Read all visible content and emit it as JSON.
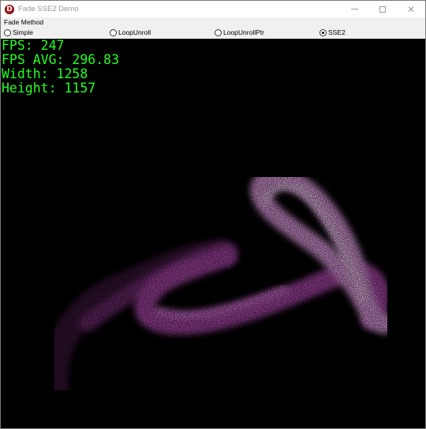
{
  "window": {
    "title": "Fade SSE2 Demo",
    "app_icon_letter": "D",
    "controls": [
      "minimize-icon",
      "maximize-icon",
      "close-icon"
    ]
  },
  "fade_method": {
    "label": "Fade Method",
    "options": [
      {
        "label": "Simple",
        "checked": false
      },
      {
        "label": "LoopUnroll",
        "checked": false
      },
      {
        "label": "LoopUnrollPtr",
        "checked": false
      },
      {
        "label": "SSE2",
        "checked": true
      }
    ]
  },
  "stats": {
    "fps": "FPS: 247",
    "fps_avg": "FPS AVG: 296.83",
    "width": "Width: 1258",
    "height": "Height: 1157"
  },
  "colors": {
    "stats_text": "#22ff22",
    "particle_bright": "#f0b0f0",
    "particle_mid": "#c050c0",
    "particle_dim": "#602860",
    "background": "#000000"
  }
}
